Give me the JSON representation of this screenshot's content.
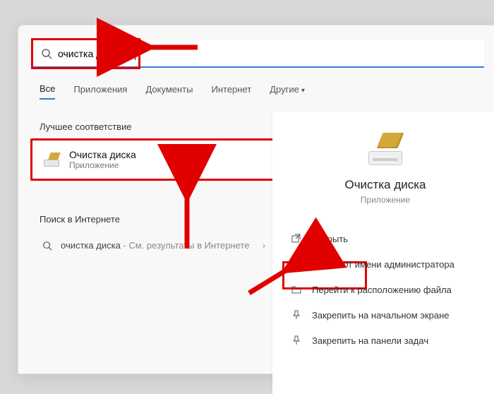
{
  "search": {
    "value": "очистка диска"
  },
  "tabs": {
    "all": "Все",
    "apps": "Приложения",
    "docs": "Документы",
    "web": "Интернет",
    "more": "Другие"
  },
  "left": {
    "best_label": "Лучшее соответствие",
    "best_title": "Очистка диска",
    "best_sub": "Приложение",
    "web_label": "Поиск в Интернете",
    "web_query": "очистка диска",
    "web_hint": " - См. результаты в Интернете"
  },
  "right": {
    "title": "Очистка диска",
    "type": "Приложение",
    "actions": {
      "open": "Открыть",
      "admin": "Запуск от имени администратора",
      "location": "Перейти к расположению файла",
      "pin_start": "Закрепить на начальном экране",
      "pin_task": "Закрепить на панели задач"
    }
  }
}
